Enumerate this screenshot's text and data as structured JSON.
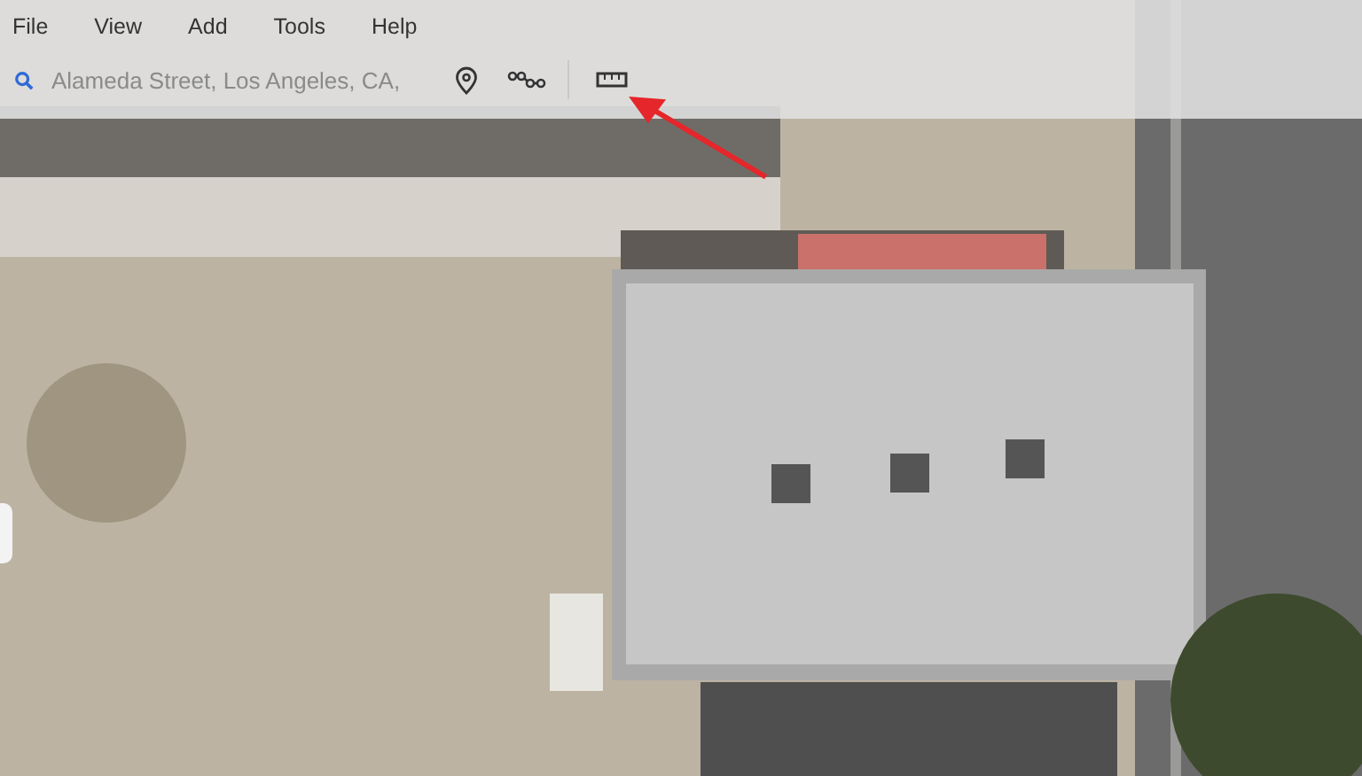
{
  "menu_bar": {
    "items": [
      {
        "label": "File"
      },
      {
        "label": "View"
      },
      {
        "label": "Add"
      },
      {
        "label": "Tools"
      },
      {
        "label": "Help"
      }
    ]
  },
  "search": {
    "placeholder": "Alameda Street, Los Angeles, CA,"
  }
}
